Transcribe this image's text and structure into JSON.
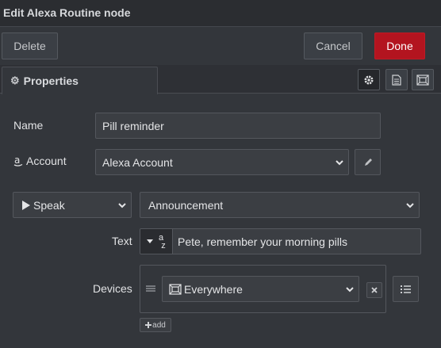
{
  "window": {
    "title": "Edit Alexa Routine node"
  },
  "toolbar": {
    "delete_label": "Delete",
    "cancel_label": "Cancel",
    "done_label": "Done"
  },
  "tabs": {
    "properties_label": "Properties"
  },
  "form": {
    "name_label": "Name",
    "name_value": "Pill reminder",
    "account_label": "Account",
    "account_value": "Alexa Account",
    "action_value": "Speak",
    "speak_mode_value": "Announcement",
    "text_label": "Text",
    "text_type_glyph": "a",
    "text_type_sub": "z",
    "text_value": "Pete, remember your morning pills",
    "devices_label": "Devices",
    "device_value": "Everywhere",
    "add_label": "add"
  },
  "colors": {
    "background": "#33363b",
    "done": "#b3141f",
    "titlebar": "#2b2d31"
  },
  "icons": [
    "gear-icon",
    "document-icon",
    "frame-icon",
    "amazon-icon",
    "pencil-icon",
    "play-icon",
    "chevron-down-icon",
    "caret-down-icon",
    "drag-handle-icon",
    "device-group-icon",
    "close-icon",
    "list-icon",
    "plus-icon"
  ]
}
